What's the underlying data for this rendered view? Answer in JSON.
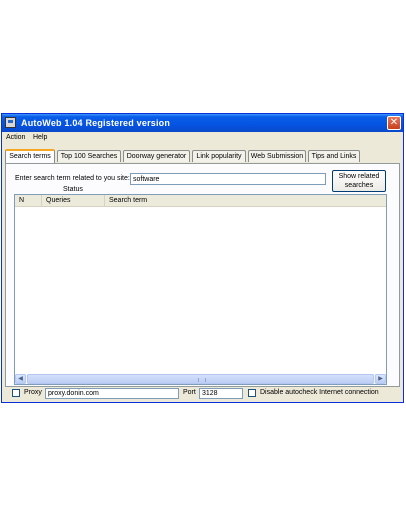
{
  "window": {
    "title": "AutoWeb 1.04 Registered version",
    "close_glyph": "✕"
  },
  "menu": [
    "Action",
    "Help"
  ],
  "tabs": [
    "Search terms",
    "Top 100 Searches",
    "Doorway generator",
    "Link popularity",
    "Web Submission",
    "Tips and Links"
  ],
  "active_tab": "Search terms",
  "search": {
    "prompt": "Enter search term related to you site:",
    "value": "software",
    "button_line1": "Show related",
    "button_line2": "searches",
    "status_label": "Status"
  },
  "table": {
    "columns": [
      "N",
      "Queries",
      "Search term"
    ],
    "rows": []
  },
  "scroll": {
    "left_glyph": "◀",
    "right_glyph": "▶"
  },
  "proxy": {
    "checkbox_label": "Proxy",
    "host": "proxy.donin.com",
    "port_label": "Port",
    "port": "3128",
    "disable_label": "Disable autocheck Internet connection"
  },
  "icons": {
    "app": "app-window-icon",
    "close": "close-icon"
  },
  "colors": {
    "titlebar": "#0553e3",
    "close": "#c8411c",
    "active_tab_accent": "#f5a623"
  }
}
